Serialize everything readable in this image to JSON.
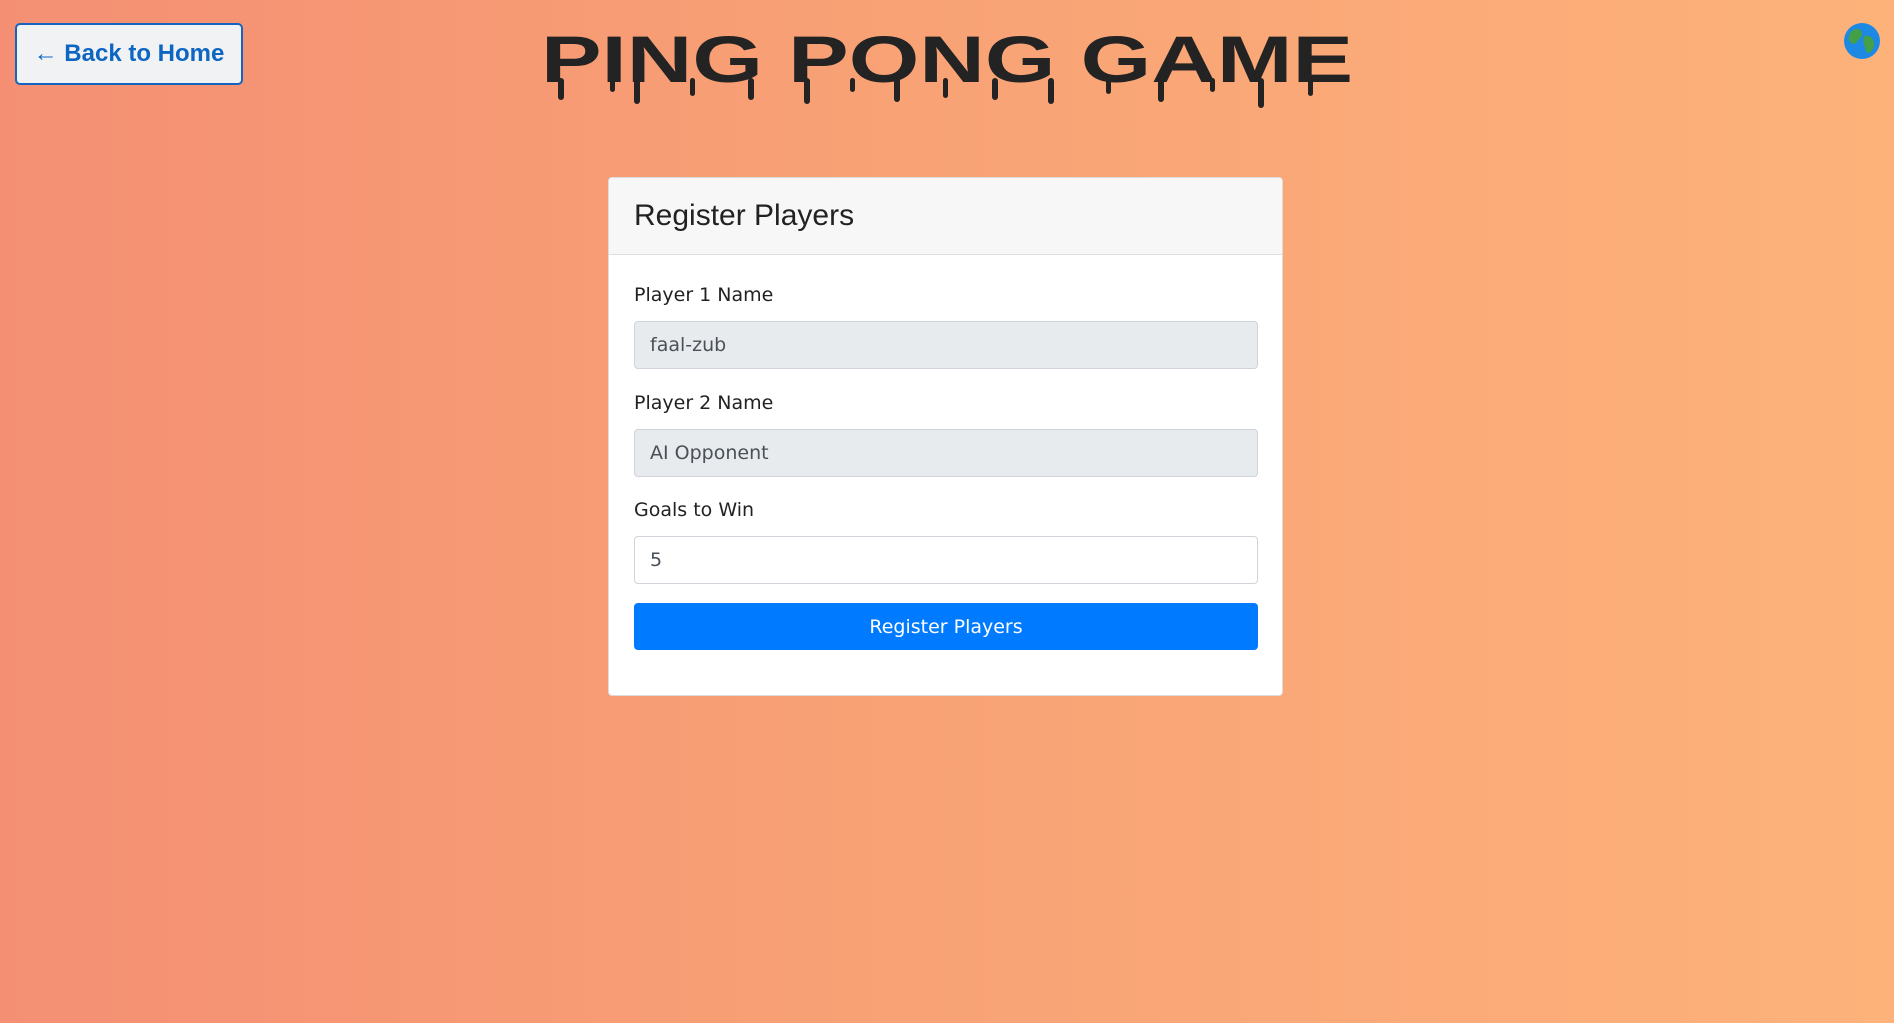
{
  "header": {
    "back_label": "← Back to Home",
    "title": "PING PONG GAME",
    "language_icon": "globe-icon"
  },
  "form": {
    "heading": "Register Players",
    "player1_label": "Player 1 Name",
    "player1_value": "faal-zub",
    "player2_label": "Player 2 Name",
    "player2_value": "AI Opponent",
    "goals_label": "Goals to Win",
    "goals_value": "5",
    "submit_label": "Register Players"
  },
  "colors": {
    "accent": "#007bff",
    "link": "#0d66c2",
    "background_start": "#f48f74",
    "background_end": "#fdb27a"
  }
}
